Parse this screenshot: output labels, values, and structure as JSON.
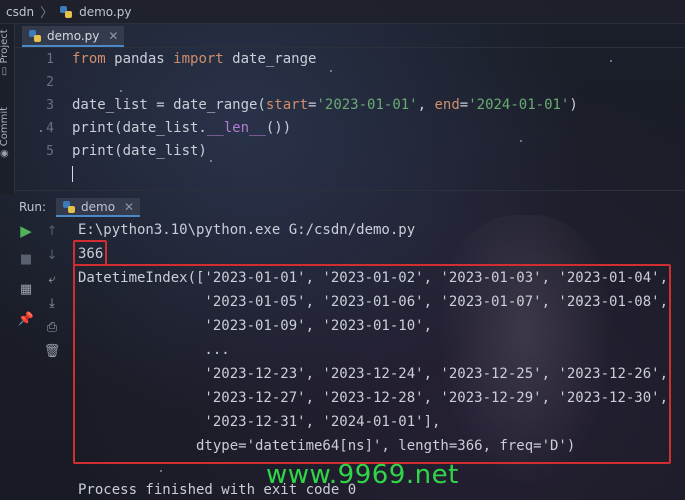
{
  "breadcrumb": {
    "project": "csdn",
    "file": "demo.py"
  },
  "left_strip": {
    "project_label": "Project",
    "commit_label": "Commit"
  },
  "editor": {
    "tab_label": "demo.py",
    "line_numbers": [
      "1",
      "2",
      "3",
      "4",
      "5"
    ],
    "lines": {
      "l1": {
        "from": "from",
        "module": " pandas ",
        "import": "import",
        "name": " date_range"
      },
      "l3": {
        "a": "date_list = date_range(",
        "start_kw": "start",
        "eq1": "=",
        "start_val": "'2023-01-01'",
        "comma": ", ",
        "end_kw": "end",
        "eq2": "=",
        "end_val": "'2024-01-01'",
        "close": ")"
      },
      "l4": {
        "a": "print(date_list.",
        "dunder": "__len__",
        "b": "())"
      },
      "l5": {
        "a": "print(date_list)"
      }
    }
  },
  "run_panel": {
    "run_label": "Run:",
    "tab_label": "demo",
    "tool_icons": [
      "run-icon",
      "stop-icon",
      "layout-icon",
      "pin-icon",
      "up-arrow-icon",
      "down-arrow-icon",
      "soft-wrap-icon",
      "scroll-to-end-icon",
      "print-icon",
      "delete-icon"
    ]
  },
  "console": {
    "command": "E:\\python3.10\\python.exe G:/csdn/demo.py",
    "len_output": "366",
    "index_lines": [
      "DatetimeIndex(['2023-01-01', '2023-01-02', '2023-01-03', '2023-01-04',",
      "               '2023-01-05', '2023-01-06', '2023-01-07', '2023-01-08',",
      "               '2023-01-09', '2023-01-10',",
      "               ...",
      "               '2023-12-23', '2023-12-24', '2023-12-25', '2023-12-26',",
      "               '2023-12-27', '2023-12-28', '2023-12-29', '2023-12-30',",
      "               '2023-12-31', '2024-01-01'],",
      "              dtype='datetime64[ns]', length=366, freq='D')"
    ],
    "exit_message": "Process finished with exit code 0"
  },
  "watermark": "www.9969.net",
  "colors": {
    "highlight_box": "#d12f2f",
    "watermark": "#2fe04a",
    "keyword": "#cf8e6d",
    "string": "#6aab73"
  }
}
